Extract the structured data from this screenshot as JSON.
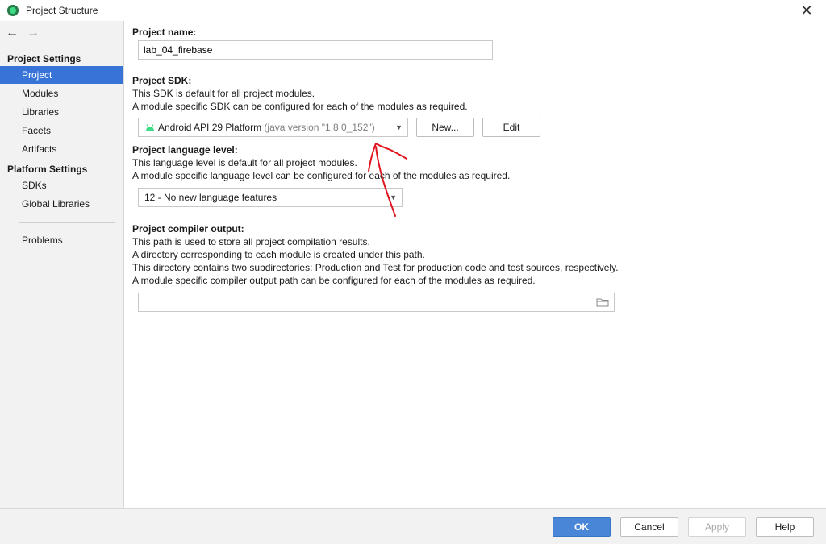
{
  "window": {
    "title": "Project Structure"
  },
  "sidebar": {
    "project_settings_heading": "Project Settings",
    "project_items": [
      {
        "label": "Project",
        "selected": true
      },
      {
        "label": "Modules"
      },
      {
        "label": "Libraries"
      },
      {
        "label": "Facets"
      },
      {
        "label": "Artifacts"
      }
    ],
    "platform_settings_heading": "Platform Settings",
    "platform_items": [
      {
        "label": "SDKs"
      },
      {
        "label": "Global Libraries"
      }
    ],
    "problems_label": "Problems"
  },
  "main": {
    "project_name": {
      "label": "Project name:",
      "value": "lab_04_firebase"
    },
    "sdk": {
      "label": "Project SDK:",
      "desc1": "This SDK is default for all project modules.",
      "desc2": "A module specific SDK can be configured for each of the modules as required.",
      "selected_name": "Android API 29 Platform",
      "selected_detail": "(java version \"1.8.0_152\")",
      "new_button": "New...",
      "edit_button": "Edit"
    },
    "language_level": {
      "label": "Project language level:",
      "desc1": "This language level is default for all project modules.",
      "desc2": "A module specific language level can be configured for each of the modules as required.",
      "selected": "12 - No new language features"
    },
    "compiler_output": {
      "label": "Project compiler output:",
      "desc1": "This path is used to store all project compilation results.",
      "desc2": "A directory corresponding to each module is created under this path.",
      "desc3": "This directory contains two subdirectories: Production and Test for production code and test sources, respectively.",
      "desc4": "A module specific compiler output path can be configured for each of the modules as required.",
      "value": ""
    }
  },
  "footer": {
    "ok": "OK",
    "cancel": "Cancel",
    "apply": "Apply",
    "help": "Help"
  },
  "colors": {
    "selection": "#3874d8",
    "primary_button": "#4a86d8",
    "annotation": "#e0141e"
  }
}
